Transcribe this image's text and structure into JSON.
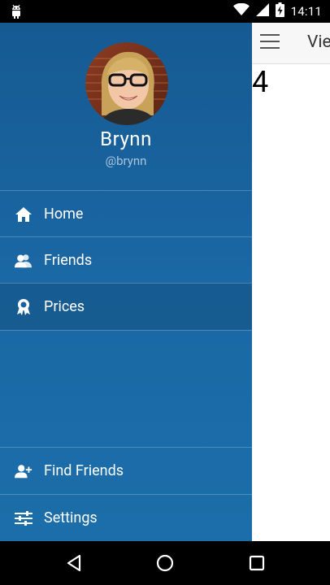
{
  "status_bar": {
    "time": "14:11",
    "icons": [
      "android-icon",
      "wifi-icon",
      "signal-icon",
      "battery-charging-icon"
    ]
  },
  "content": {
    "toolbar_title": "Vie",
    "counter": "4"
  },
  "drawer": {
    "profile": {
      "name": "Brynn",
      "handle": "@brynn"
    },
    "menu": [
      {
        "label": "Home",
        "icon": "home-icon"
      },
      {
        "label": "Friends",
        "icon": "friends-icon"
      },
      {
        "label": "Prices",
        "icon": "award-icon",
        "selected": true
      }
    ],
    "footer_menu": [
      {
        "label": "Find Friends",
        "icon": "add-person-icon"
      },
      {
        "label": "Settings",
        "icon": "settings-sliders-icon"
      }
    ]
  },
  "nav_bar": {
    "buttons": [
      "back-icon",
      "home-circle-icon",
      "recents-icon"
    ]
  },
  "colors": {
    "drawer_top": "#165a92",
    "drawer_bottom": "#1b6ea9",
    "handle_text": "#a9c4de"
  }
}
